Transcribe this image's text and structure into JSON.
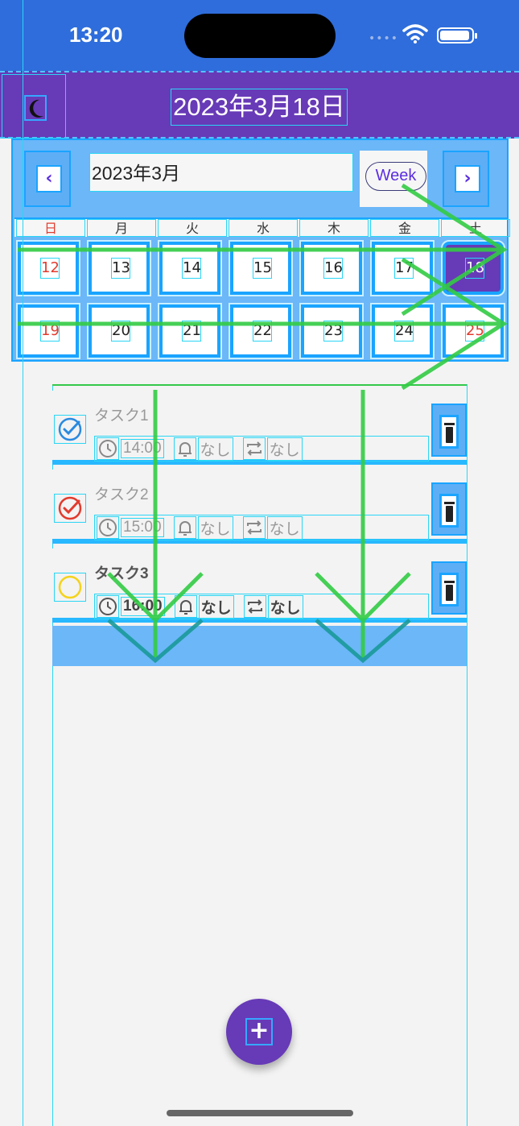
{
  "status_bar": {
    "time": "13:20",
    "dots": "••••"
  },
  "header": {
    "title": "2023年3月18日"
  },
  "calendar": {
    "month_label": "2023年3月",
    "prev_icon": "‹",
    "next_icon": "›",
    "week_button_label": "Week",
    "weekdays": [
      "日",
      "月",
      "火",
      "水",
      "木",
      "金",
      "土"
    ],
    "week1": [
      "12",
      "13",
      "14",
      "15",
      "16",
      "17",
      "18"
    ],
    "week2": [
      "19",
      "20",
      "21",
      "22",
      "23",
      "24",
      "25"
    ],
    "selected_day": "18",
    "accent": "#673ab7",
    "sunday_color": "#e23b2e"
  },
  "tasks": [
    {
      "name": "タスク1",
      "time": "14:00",
      "reminder": "なし",
      "repeat": "なし",
      "status_icon": "check-circle-blue-icon"
    },
    {
      "name": "タスク2",
      "time": "15:00",
      "reminder": "なし",
      "repeat": "なし",
      "status_icon": "check-circle-red-icon"
    },
    {
      "name": "タスク3",
      "time": "16:00",
      "reminder": "なし",
      "repeat": "なし",
      "status_icon": "circle-yellow-icon"
    }
  ],
  "fab": {
    "label": "+"
  }
}
